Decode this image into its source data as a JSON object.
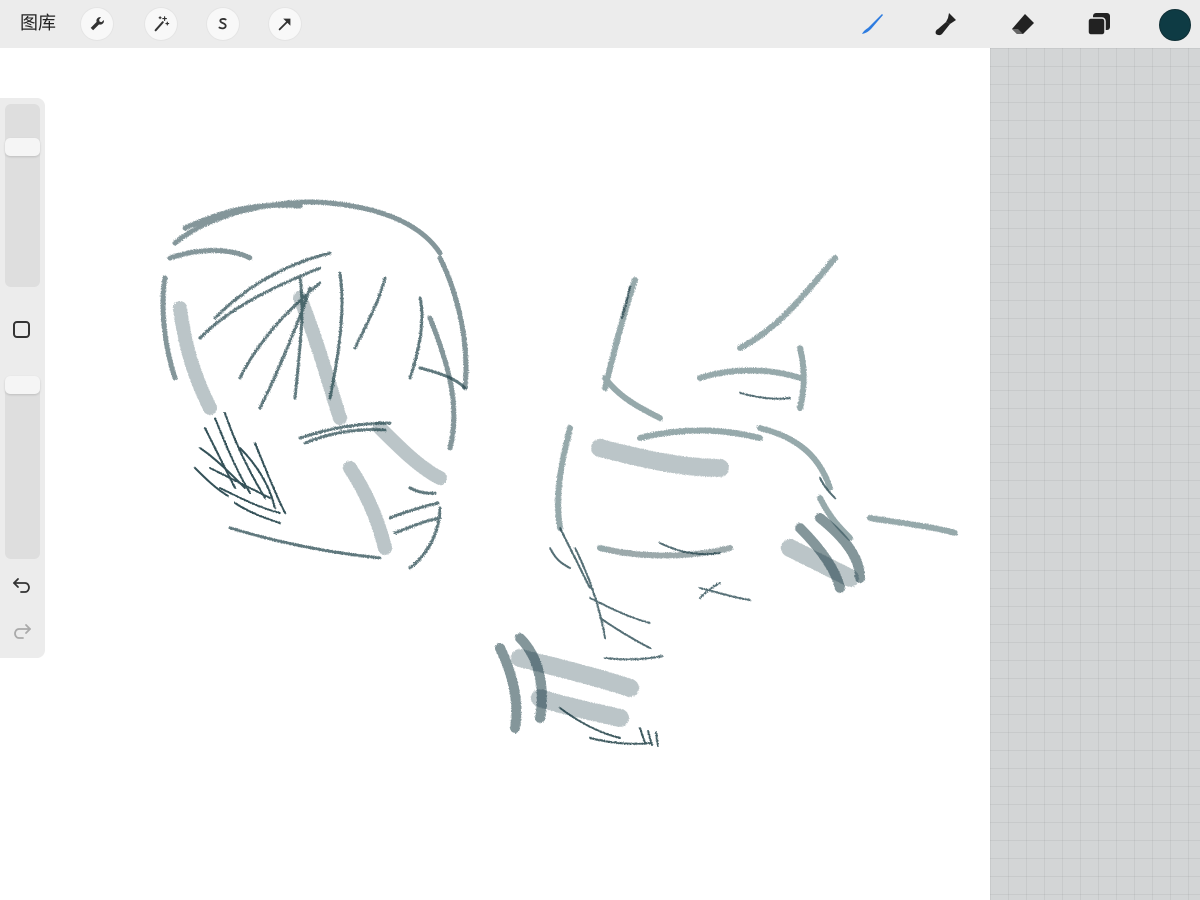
{
  "toolbar": {
    "gallery_label": "图库",
    "left_tools": [
      "wrench-icon",
      "magic-wand-icon",
      "selection-s-icon",
      "transform-arrow-icon"
    ],
    "right_tools": [
      "brush-icon",
      "smudge-icon",
      "eraser-icon",
      "layers-icon"
    ],
    "active_tool": "brush-icon",
    "active_color": "#0e3b44",
    "brush_active_color": "#2e7ce0"
  },
  "sidebar": {
    "tools": [
      "brush-size-slider",
      "modify-button",
      "opacity-slider",
      "undo-icon",
      "redo-icon"
    ]
  },
  "canvas": {
    "ink_color": "#1e3f47"
  }
}
